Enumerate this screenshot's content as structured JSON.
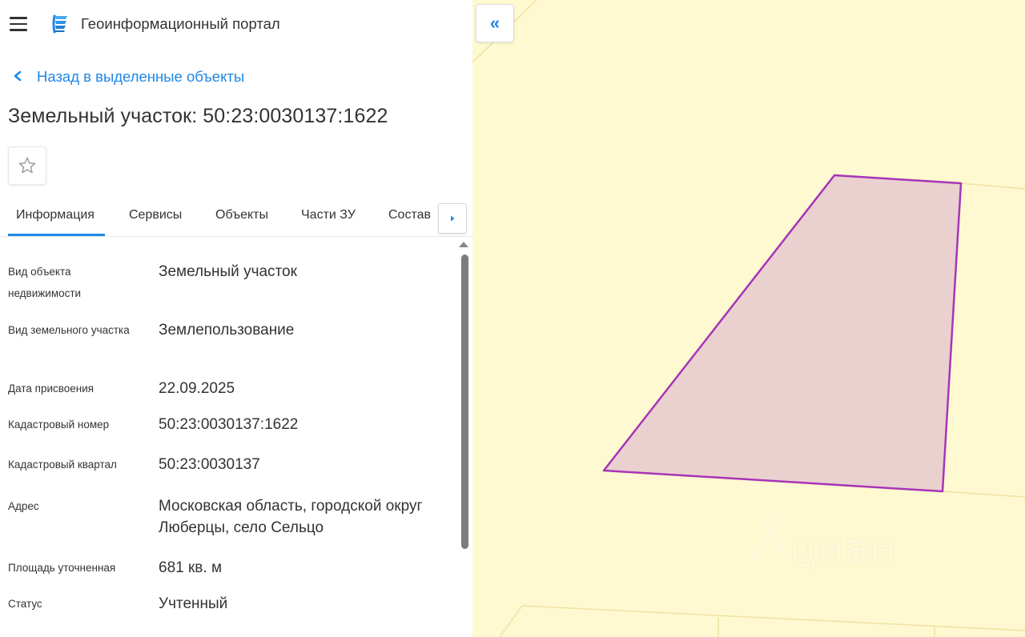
{
  "header": {
    "app_title": "Геоинформационный портал",
    "menu_icon": "hamburger-menu-icon",
    "logo_icon": "portal-logo-icon"
  },
  "back_link": {
    "label": "Назад в выделенные объекты",
    "icon": "chevron-left-icon"
  },
  "page_title": "Земельный участок: 50:23:0030137:1622",
  "favorite_icon": "star-outline-icon",
  "tabs": [
    {
      "label": "Информация",
      "active": true
    },
    {
      "label": "Сервисы",
      "active": false
    },
    {
      "label": "Объекты",
      "active": false
    },
    {
      "label": "Части ЗУ",
      "active": false
    },
    {
      "label": "Состав",
      "active": false
    }
  ],
  "tabs_next_icon": "caret-right-icon",
  "info": [
    {
      "label": "Вид объекта недвижимости",
      "value": "Земельный участок"
    },
    {
      "label": "Вид земельного участка",
      "value": "Землепользование"
    },
    {
      "label": "Дата присвоения",
      "value": "22.09.2025"
    },
    {
      "label": "Кадастровый номер",
      "value": "50:23:0030137:1622"
    },
    {
      "label": "Кадастровый квартал",
      "value": "50:23:0030137"
    },
    {
      "label": "Адрес",
      "value": "Московская область, городской округ Люберцы, село Сельцо"
    },
    {
      "label": "Площадь уточненная",
      "value": "681 кв. м"
    },
    {
      "label": "Статус",
      "value": "Учтенный"
    }
  ],
  "map": {
    "collapse_icon": "double-chevron-left-icon",
    "collapse_label": "«",
    "watermark": "циан",
    "background_color": "#fef9d1",
    "parcel_fill": "#ead0cf",
    "parcel_stroke": "#a734b8",
    "boundary_color": "#efe2a0"
  },
  "colors": {
    "accent": "#1e88e5",
    "text": "#333333"
  }
}
